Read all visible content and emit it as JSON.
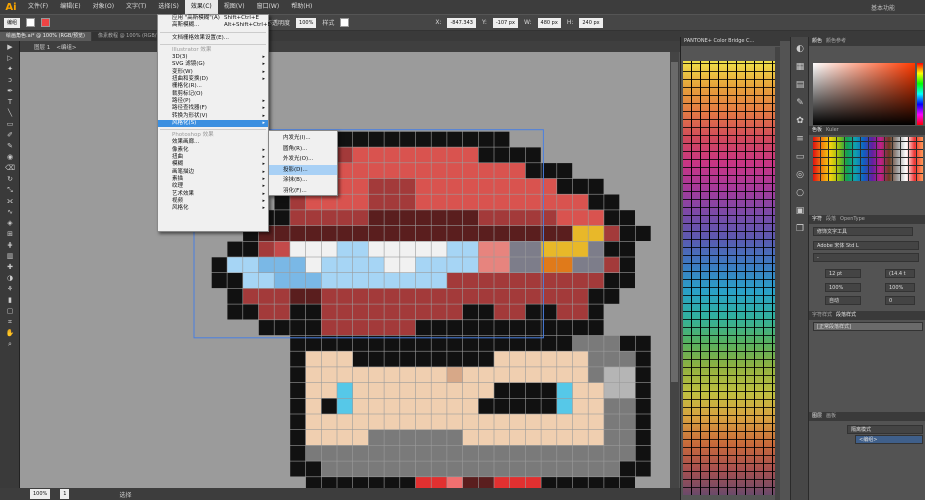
{
  "app": {
    "logo": "Ai",
    "workspace": "基本功能"
  },
  "menubar": [
    "文件(F)",
    "编辑(E)",
    "对象(O)",
    "文字(T)",
    "选择(S)",
    "效果(C)",
    "视图(V)",
    "窗口(W)",
    "帮助(H)"
  ],
  "control": {
    "mode": "编组",
    "opacity": "不透明度",
    "style": "样式",
    "x": "-847.343",
    "y": "-107 px",
    "w": "480 px",
    "h": "240 px",
    "zoom": "100%"
  },
  "tabs": [
    "绘画角色.ai* @ 100% (RGB/预览)",
    "像素教程 @ 100% (RGB/预览)",
    "*.ai @ 66.67% (RGB/预览)"
  ],
  "path": [
    "图层 1",
    "<编组>"
  ],
  "status": {
    "zoom": "100%",
    "page": "1",
    "label": "选择"
  },
  "menu": {
    "items": [
      {
        "label": "应用 \"高斯模糊\"(A)",
        "key": "Shift+Ctrl+E"
      },
      {
        "label": "高斯模糊...",
        "key": "Alt+Shift+Ctrl+E"
      },
      {
        "sep": true
      },
      {
        "label": "文档栅格效果设置(E)..."
      },
      {
        "sep": true
      },
      {
        "label": "Illustrator 效果",
        "header": true
      },
      {
        "label": "3D(3)",
        "arrow": true
      },
      {
        "label": "SVG 滤镜(G)",
        "arrow": true
      },
      {
        "label": "变形(W)",
        "arrow": true
      },
      {
        "label": "扭曲和变换(D)",
        "arrow": true
      },
      {
        "label": "栅格化(R)..."
      },
      {
        "label": "裁剪标记(O)"
      },
      {
        "label": "路径(P)",
        "arrow": true
      },
      {
        "label": "路径查找器(F)",
        "arrow": true
      },
      {
        "label": "转换为形状(V)",
        "arrow": true
      },
      {
        "label": "风格化(S)",
        "arrow": true,
        "selected": true
      },
      {
        "sep": true
      },
      {
        "label": "Photoshop 效果",
        "header": true
      },
      {
        "label": "效果画廊..."
      },
      {
        "label": "像素化",
        "arrow": true
      },
      {
        "label": "扭曲",
        "arrow": true
      },
      {
        "label": "模糊",
        "arrow": true
      },
      {
        "label": "画笔描边",
        "arrow": true
      },
      {
        "label": "素描",
        "arrow": true
      },
      {
        "label": "纹理",
        "arrow": true
      },
      {
        "label": "艺术效果",
        "arrow": true
      },
      {
        "label": "视频",
        "arrow": true
      },
      {
        "label": "风格化",
        "arrow": true
      }
    ],
    "submenu": [
      "内发光(I)...",
      "圆角(R)...",
      "外发光(O)...",
      "投影(D)...",
      "涂抹(B)...",
      "羽化(F)..."
    ],
    "submenu_selected": 3
  },
  "pantone": {
    "title": "PANTONE+ Color Bridge C..."
  },
  "right": {
    "color_tabs": [
      "颜色",
      "颜色参考"
    ],
    "swatch_tabs": [
      "色板",
      "Kuler"
    ],
    "type_tabs": [
      "字符",
      "段落",
      "OpenType"
    ],
    "touch_tool": "修饰文字工具",
    "font": "Adobe 宋体 Std L",
    "font_style": "-",
    "size": "12 pt",
    "leading": "(14.4 t",
    "tracking": "100%",
    "scale": "100%",
    "kern": "自动",
    "track2": "0",
    "style_tabs": [
      "字符样式",
      "段落样式"
    ],
    "para_style": "[正常段落样式]",
    "layer_tabs": [
      "图层",
      "画板"
    ],
    "layers": [
      "隔离模式",
      "<编组>"
    ]
  },
  "tools": [
    "pointer",
    "direct-select",
    "magic-wand",
    "lasso",
    "pen",
    "type",
    "line",
    "rect",
    "brush",
    "pencil",
    "blob",
    "eraser",
    "rotate",
    "scale",
    "width",
    "warp",
    "shape-builder",
    "perspective",
    "mesh",
    "gradient",
    "eyedropper",
    "blend",
    "symbol",
    "graph",
    "artboard",
    "slice",
    "hand",
    "zoom"
  ],
  "palette": {
    ".": "#9b9b9b",
    "K": "#111111",
    "D": "#5a1e1e",
    "R": "#a33a3a",
    "r": "#c44a4a",
    "L": "#d9534f",
    "P": "#e7847e",
    "W": "#f1f1f1",
    "B": "#a6d5f5",
    "b": "#7ab8e6",
    "Y": "#e8b829",
    "O": "#e07a1a",
    "g": "#7d7d8a",
    "S": "#f0cfb0",
    "s": "#d7a888",
    "G": "#7a7a7a",
    "H": "#b5b5b5",
    "C": "#56c8e8",
    "E": "#e23030",
    "e": "#f07070",
    "w": "#ffffff"
  },
  "pixels": [
    "......................................",
    "........KKKKKKKKKKKK..................",
    "......KKRRLLLLLLLLKKKK................",
    "......KRLLLLLLLLLLLLLKKK..............",
    ".....KRLLLLRRRLLLLLLLLLKKK............",
    ".....KRLLLLRRRLLLLLLLLLLLKK...........",
    "....KKRRRRRDDDDDDDRRRRRLLLKK..........",
    "...KDDDDDDDDDDDDDDDDDDDDYYRKK.........",
    "..KKRrWWWBBWWWWWBBPPggYYYgKK..........",
    ".KBBbbbWBBBBWWBBBBPPggOOggRK..........",
    ".KKBBbbbBBBBBBBBRRRRRRRRRRKK..........",
    "..KRRRDDRRRRRRRRRRRRRRRRRKK...........",
    "..KKRRKKRRRRRRRRRKKRRKKRRK............",
    "....KKKKRRRRRRKKKKKKKKKKKK............",
    "......KKKKKKKKKKKKKKKKKKGGGKK.........",
    "......KSSSKKKKKKKKKSSSSSSGGGK.........",
    "......KSSSSSSSSSsSSSSSSSSGHHK.........",
    "......KSSCSSSSSSSSSKKKKCSSHHK.........",
    "......KSKCSSSSSSSSKKKKKCSSGGK.........",
    "......KSSSSSSSSSSSSSSSSSSSGGK.........",
    "......KSSSSGGGGGGSSSSSSSSSGGK.........",
    "......KGGGGGGGGGGGGGGGGGGGGGK.........",
    "......KKGGGGGGGGGGGGGGGGGGGKK.........",
    ".......KKKKKKKEEeDDEEEKKKKKK..........",
    ".........KEEEEEeDDEEEEEEK.............",
    "........KEEEEEeeDDEEEEEEEK............"
  ]
}
